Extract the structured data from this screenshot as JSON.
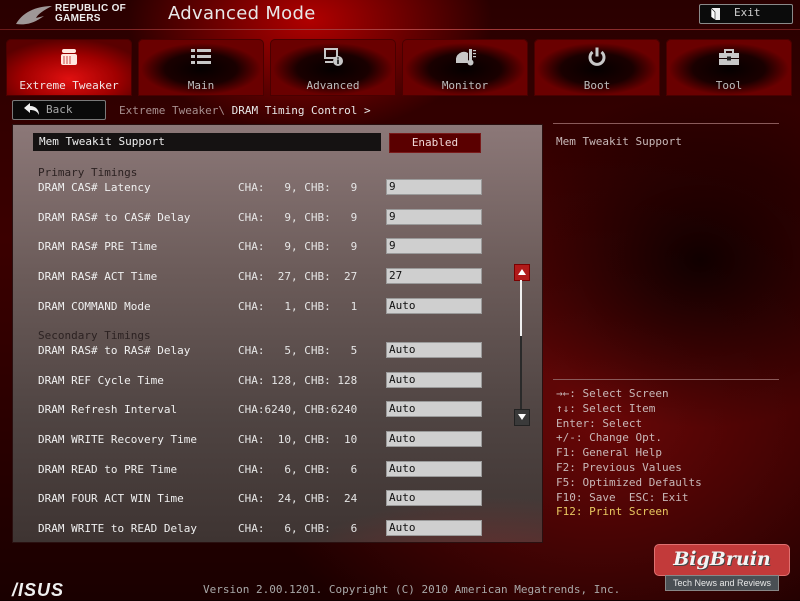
{
  "header": {
    "brand_line1": "REPUBLIC OF",
    "brand_line2": "GAMERS",
    "title": "Advanced Mode",
    "exit_label": "Exit"
  },
  "tabs": [
    {
      "label": "Extreme Tweaker",
      "icon": "cpu-tweak-icon",
      "active": true
    },
    {
      "label": "Main",
      "icon": "list-icon",
      "active": false
    },
    {
      "label": "Advanced",
      "icon": "advanced-info-icon",
      "active": false
    },
    {
      "label": "Monitor",
      "icon": "thermometer-gauge-icon",
      "active": false
    },
    {
      "label": "Boot",
      "icon": "power-icon",
      "active": false
    },
    {
      "label": "Tool",
      "icon": "toolbox-icon",
      "active": false
    }
  ],
  "nav": {
    "back_label": "Back",
    "breadcrumb_parent": "Extreme Tweaker\\",
    "breadcrumb_current": " DRAM Timing Control >"
  },
  "main": {
    "header_item": {
      "label": "Mem Tweakit Support",
      "value": "Enabled"
    },
    "primary_section": "Primary Timings",
    "secondary_section": "Secondary Timings",
    "primary": [
      {
        "name": "DRAM CAS# Latency",
        "channels": "CHA:   9, CHB:   9",
        "value": "9"
      },
      {
        "name": "DRAM RAS# to CAS# Delay",
        "channels": "CHA:   9, CHB:   9",
        "value": "9"
      },
      {
        "name": "DRAM RAS# PRE Time",
        "channels": "CHA:   9, CHB:   9",
        "value": "9"
      },
      {
        "name": "DRAM RAS# ACT Time",
        "channels": "CHA:  27, CHB:  27",
        "value": "27"
      },
      {
        "name": "DRAM COMMAND Mode",
        "channels": "CHA:   1, CHB:   1",
        "value": "Auto"
      }
    ],
    "secondary": [
      {
        "name": "DRAM RAS# to RAS# Delay",
        "channels": "CHA:   5, CHB:   5",
        "value": "Auto"
      },
      {
        "name": "DRAM REF Cycle Time",
        "channels": "CHA: 128, CHB: 128",
        "value": "Auto"
      },
      {
        "name": "DRAM Refresh Interval",
        "channels": "CHA:6240, CHB:6240",
        "value": "Auto"
      },
      {
        "name": "DRAM WRITE Recovery Time",
        "channels": "CHA:  10, CHB:  10",
        "value": "Auto"
      },
      {
        "name": "DRAM READ to PRE Time",
        "channels": "CHA:   6, CHB:   6",
        "value": "Auto"
      },
      {
        "name": "DRAM FOUR ACT WIN Time",
        "channels": "CHA:  24, CHB:  24",
        "value": "Auto"
      },
      {
        "name": "DRAM WRITE to READ Delay",
        "channels": "CHA:   6, CHB:   6",
        "value": "Auto"
      }
    ]
  },
  "help": {
    "title": "Mem Tweakit Support",
    "keys": [
      "→←: Select Screen",
      "↑↓: Select Item",
      "Enter: Select",
      "+/-: Change Opt.",
      "F1: General Help",
      "F2: Previous Values",
      "F5: Optimized Defaults",
      "F10: Save  ESC: Exit",
      "F12: Print Screen"
    ],
    "highlight_color": "#e8c860"
  },
  "footer": {
    "brand": "/ISUS",
    "version": "Version 2.00.1201. Copyright (C) 2010 American Megatrends, Inc.",
    "watermark_title": "BigBruin",
    "watermark_sub": "Tech News and Reviews"
  },
  "colors": {
    "accent": "#b01a1a",
    "active_tab": "#e01010",
    "enabled_box": "#5a0000"
  }
}
